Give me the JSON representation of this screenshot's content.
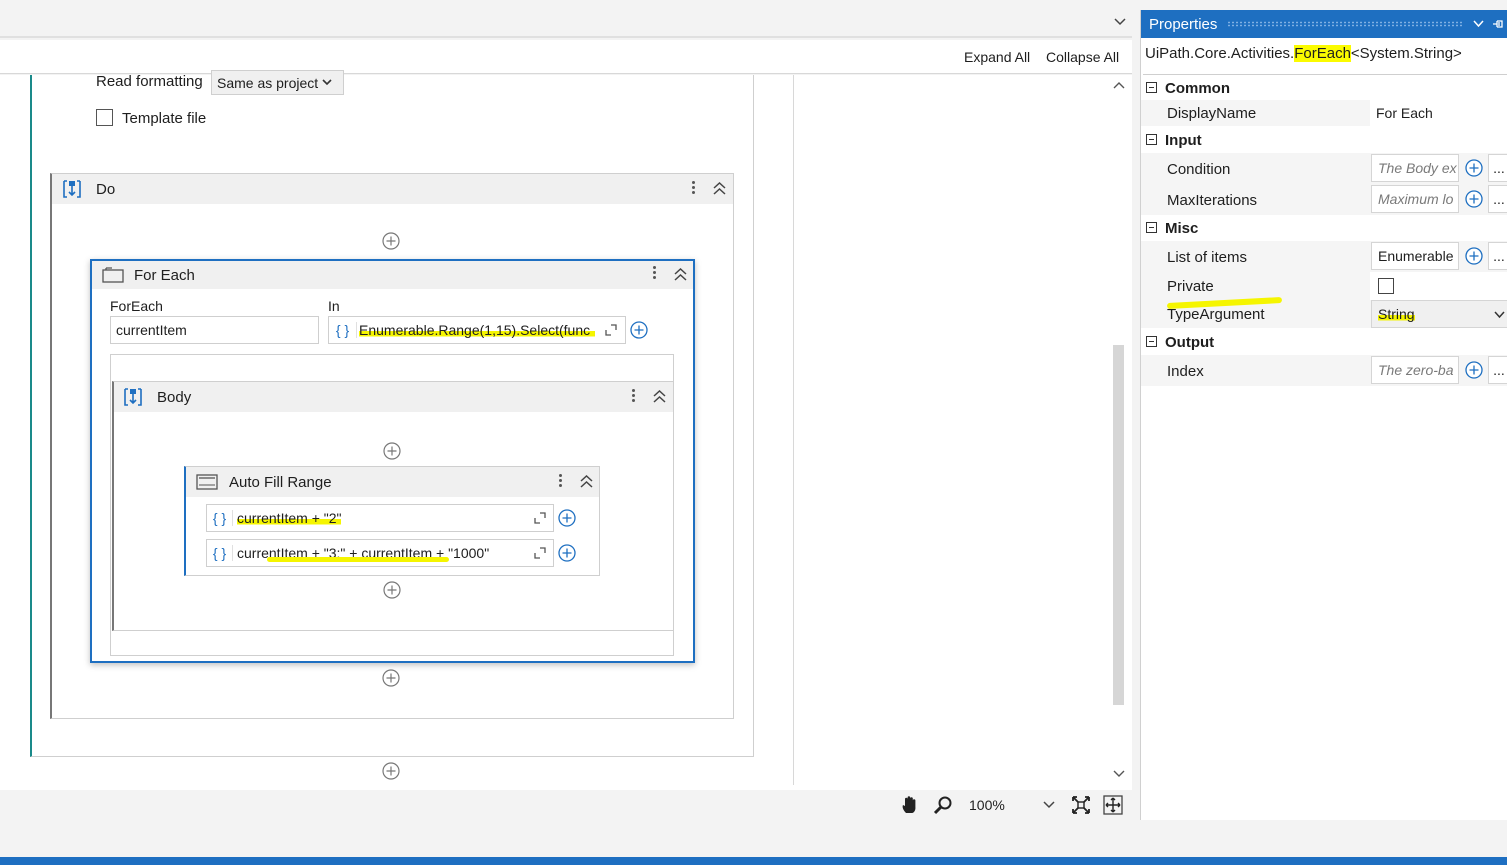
{
  "toolbar": {
    "expand_all": "Expand All",
    "collapse_all": "Collapse All"
  },
  "excel_props": {
    "read_formatting_label": "Read formatting",
    "read_formatting_value": "Same as project",
    "template_file_label": "Template file"
  },
  "do_sequence": {
    "title": "Do"
  },
  "for_each": {
    "title": "For Each",
    "foreach_label": "ForEach",
    "foreach_value": "currentItem",
    "in_label": "In",
    "in_value": "Enumerable.Range(1,15).Select(func"
  },
  "body": {
    "title": "Body"
  },
  "auto_fill": {
    "title": "Auto Fill Range",
    "source_value": "currentItem + \"2\"",
    "destination_value": "currentItem + \"3:\" + currentItem + \"1000\""
  },
  "zoom": {
    "level": "100%"
  },
  "properties": {
    "title": "Properties",
    "type_name_prefix": "UiPath.Core.Activities.",
    "type_name_highlight": "ForEach",
    "type_name_suffix": "<System.String>",
    "categories": {
      "common": "Common",
      "input": "Input",
      "misc": "Misc",
      "output": "Output"
    },
    "display_name_label": "DisplayName",
    "display_name_value": "For Each",
    "condition_label": "Condition",
    "condition_placeholder": "The Body ex",
    "max_iterations_label": "MaxIterations",
    "max_iterations_placeholder": "Maximum lo",
    "list_of_items_label": "List of items",
    "list_of_items_value": "Enumerable",
    "private_label": "Private",
    "type_argument_label": "TypeArgument",
    "type_argument_value": "String",
    "index_label": "Index",
    "index_placeholder": "The zero-ba",
    "more_button": "..."
  },
  "colors": {
    "accent": "#1e6fc1",
    "highlight": "#f5f500"
  }
}
